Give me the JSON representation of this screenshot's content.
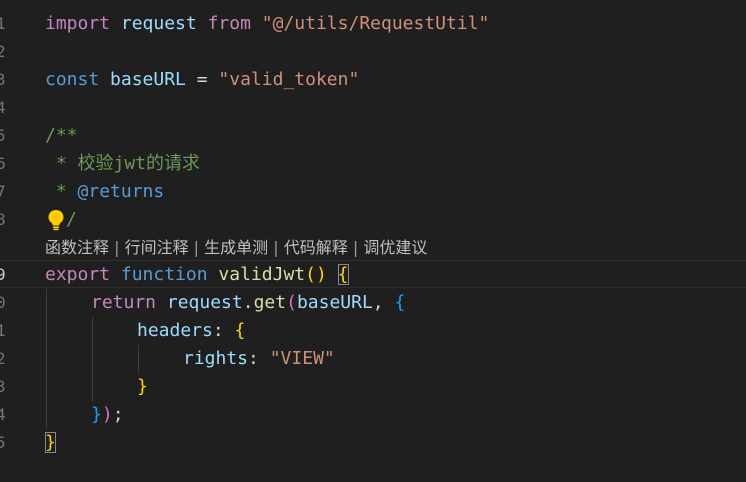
{
  "line_numbers": [
    "1",
    "2",
    "3",
    "4",
    "5",
    "6",
    "7",
    "8",
    "9",
    "0",
    "1",
    "2",
    "3",
    "4",
    "5"
  ],
  "active_line_index": 8,
  "code": {
    "l1": {
      "import": "import",
      "request": "request",
      "from": "from",
      "path": "\"@/utils/RequestUtil\""
    },
    "l3": {
      "const": "const",
      "name": "baseURL",
      "eq": "=",
      "value": "\"valid_token\""
    },
    "l5": {
      "text": "/**"
    },
    "l6": {
      "text": " * 校验jwt的请求"
    },
    "l7": {
      "star": " * ",
      "tag": "@returns"
    },
    "l8": {
      "text": "/"
    },
    "l9": {
      "export": "export",
      "function": "function",
      "name": "validJwt",
      "parens": "()",
      "brace": "{"
    },
    "l10": {
      "return": "return",
      "obj": "request",
      "dot": ".",
      "method": "get",
      "paren": "(",
      "arg": "baseURL",
      "comma": ",",
      "brace": "{"
    },
    "l11": {
      "key": "headers",
      "colon": ":",
      "brace": "{"
    },
    "l12": {
      "key": "rights",
      "colon": ":",
      "value": "\"VIEW\""
    },
    "l13": {
      "brace": "}"
    },
    "l14": {
      "brace": "}",
      "paren": ")",
      "semi": ";"
    },
    "l15": {
      "brace": "}"
    }
  },
  "codelens": {
    "items": [
      "函数注释",
      "行间注释",
      "生成单测",
      "代码解释",
      "调优建议"
    ],
    "separator": " | "
  },
  "colors": {
    "background": "#1f1f1f",
    "keyword": "#c586c0",
    "storage": "#569cd6",
    "variable": "#9cdcfe",
    "function": "#dcdcaa",
    "string": "#ce9178",
    "comment": "#6a9955",
    "bracket_level1": "#ffd700",
    "bracket_level2": "#da70d6",
    "bracket_level3": "#179fff"
  },
  "icons": {
    "lightbulb": "lightbulb-icon"
  }
}
